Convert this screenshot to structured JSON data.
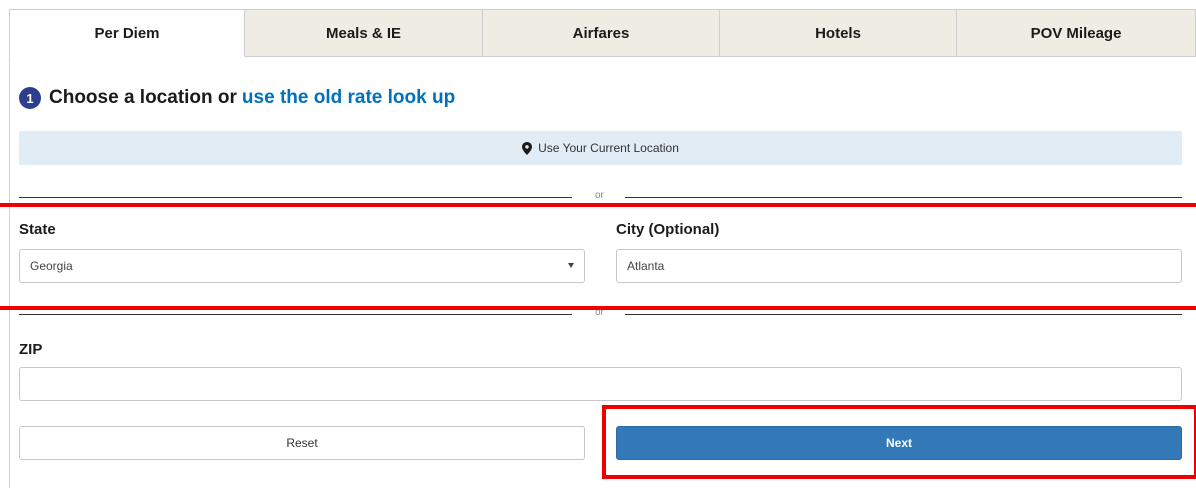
{
  "tabs": [
    {
      "label": "Per Diem",
      "active": true
    },
    {
      "label": "Meals & IE",
      "active": false
    },
    {
      "label": "Airfares",
      "active": false
    },
    {
      "label": "Hotels",
      "active": false
    },
    {
      "label": "POV Mileage",
      "active": false
    }
  ],
  "step": {
    "number": "1",
    "title": "Choose a location or",
    "link": "use the old rate look up"
  },
  "location_button": {
    "label": "Use Your Current Location",
    "icon": "map-pin-icon"
  },
  "divider_text": "or",
  "state": {
    "label": "State",
    "value": "Georgia"
  },
  "city": {
    "label": "City (Optional)",
    "value": "Atlanta"
  },
  "zip": {
    "label": "ZIP",
    "value": ""
  },
  "buttons": {
    "reset": "Reset",
    "next": "Next"
  },
  "colors": {
    "accent": "#3379b7",
    "link": "#0071bc",
    "badge": "#2d3e8f",
    "highlight": "#ee0000",
    "tab_inactive": "#efece3"
  }
}
